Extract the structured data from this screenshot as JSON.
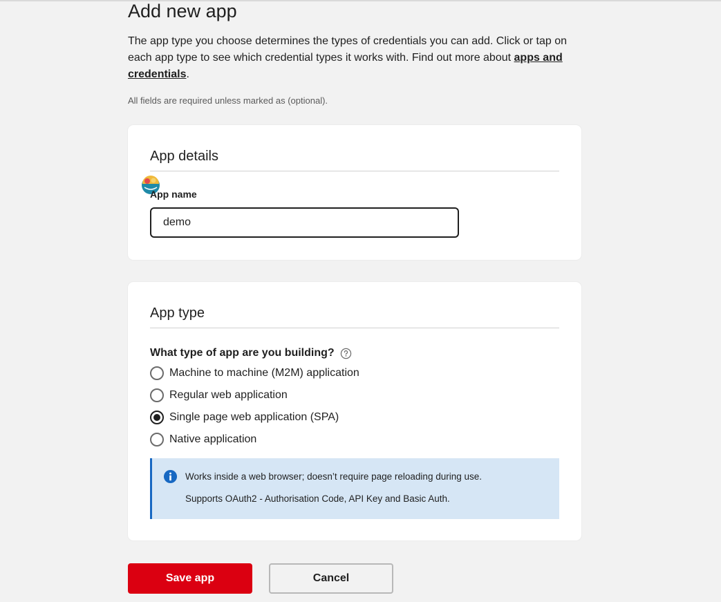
{
  "page": {
    "title": "Add new app",
    "intro_text": "The app type you choose determines the types of credentials you can add. Click or tap on each app type to see which credential types it works with. Find out more about ",
    "intro_link": "apps and credentials",
    "intro_end": ".",
    "required_note": "All fields are required unless marked as (optional)."
  },
  "app_details": {
    "heading": "App details",
    "name_label": "App name",
    "name_value": "demo"
  },
  "app_type": {
    "heading": "App type",
    "question": "What type of app are you building?",
    "help_icon": "question-circle-icon",
    "options": [
      {
        "label": "Machine to machine (M2M) application",
        "selected": false
      },
      {
        "label": "Regular web application",
        "selected": false
      },
      {
        "label": "Single page web application (SPA)",
        "selected": true
      },
      {
        "label": "Native application",
        "selected": false
      }
    ],
    "info": {
      "icon": "info-icon",
      "line1": "Works inside a web browser; doesn’t require page reloading during use.",
      "line2": "Supports OAuth2 - Authorisation Code, API Key and Basic Auth."
    }
  },
  "actions": {
    "save_label": "Save app",
    "cancel_label": "Cancel"
  },
  "colors": {
    "primary": "#db0011",
    "info_bg": "#d6e6f5",
    "info_accent": "#1768c2",
    "page_bg": "#f2f2f2"
  }
}
